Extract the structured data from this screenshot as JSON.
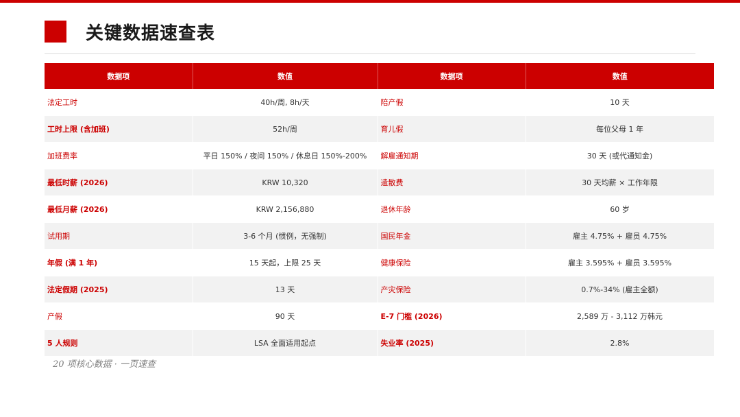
{
  "title": "关键数据速查表",
  "table": {
    "headers": [
      "数据项",
      "数值",
      "数据项",
      "数值"
    ],
    "rows": [
      {
        "label_left": "法定工时",
        "value_left": "40h/周, 8h/天",
        "label_right": "陪产假",
        "value_right": "10 天"
      },
      {
        "label_left": "工时上限 (含加班)",
        "value_left": "52h/周",
        "label_right": "育儿假",
        "value_right": "每位父母 1 年"
      },
      {
        "label_left": "加班费率",
        "value_left": "平日 150% / 夜间 150% / 休息日 150%-200%",
        "label_right": "解雇通知期",
        "value_right": "30 天 (或代通知金)"
      },
      {
        "label_left": "最低时薪 (2026)",
        "value_left": "KRW 10,320",
        "label_right": "遣散费",
        "value_right": "30 天均薪 × 工作年限"
      },
      {
        "label_left": "最低月薪 (2026)",
        "value_left": "KRW 2,156,880",
        "label_right": "退休年龄",
        "value_right": "60 岁"
      },
      {
        "label_left": "试用期",
        "value_left": "3-6 个月 (惯例，无强制)",
        "label_right": "国民年金",
        "value_right": "雇主 4.75% + 雇员 4.75%"
      },
      {
        "label_left": "年假 (满 1 年)",
        "value_left": "15 天起，上限 25 天",
        "label_right": "健康保险",
        "value_right": "雇主 3.595% + 雇员 3.595%"
      },
      {
        "label_left": "法定假期 (2025)",
        "value_left": "13 天",
        "label_right": "产灾保险",
        "value_right": "0.7%-34% (雇主全额)"
      },
      {
        "label_left": "产假",
        "value_left": "90 天",
        "label_right": "E-7 门槛 (2026)",
        "value_right": "2,589 万 - 3,112 万韩元"
      },
      {
        "label_left": "5 人规则",
        "value_left": "LSA 全面适用起点",
        "label_right": "失业率 (2025)",
        "value_right": "2.8%"
      }
    ]
  },
  "footnote": "20 项核心数据 · 一页速查",
  "colors": {
    "accent": "#cc0000",
    "zebra": "#f2f2f2",
    "text": "#333333"
  }
}
